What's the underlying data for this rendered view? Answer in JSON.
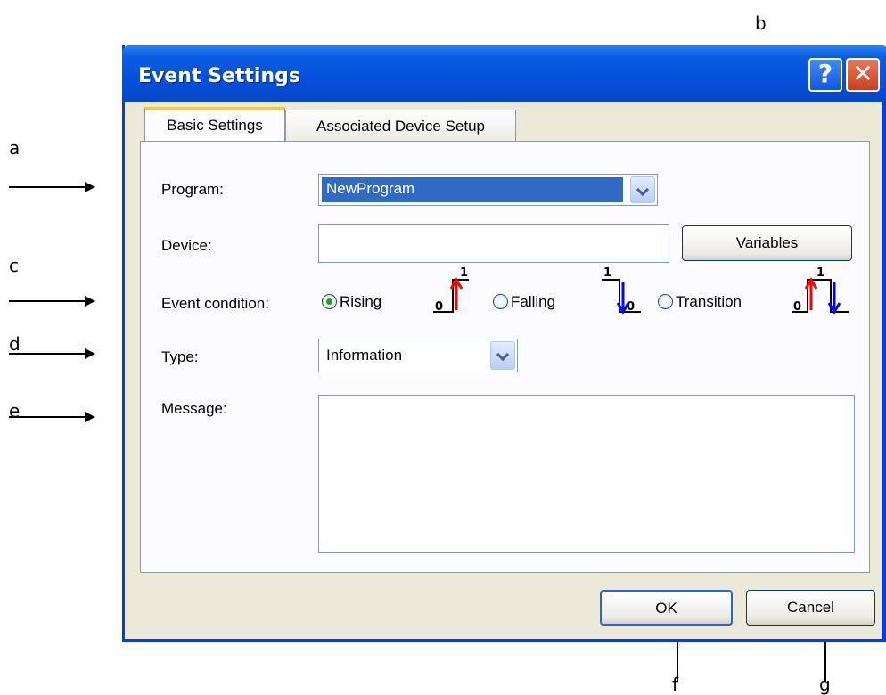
{
  "annotations": {
    "a": "a",
    "b": "b",
    "c": "c",
    "d": "d",
    "e": "e",
    "f": "f",
    "g": "g"
  },
  "window": {
    "title": "Event Settings",
    "help_label": "?",
    "close_label": "✕"
  },
  "tabs": [
    {
      "label": "Basic Settings",
      "active": true
    },
    {
      "label": "Associated Device Setup",
      "active": false
    }
  ],
  "form": {
    "program_label": "Program:",
    "program_value": "NewProgram",
    "device_label": "Device:",
    "device_value": "",
    "variables_button": "Variables",
    "event_condition_label": "Event condition:",
    "event_options": [
      {
        "label": "Rising",
        "selected": true
      },
      {
        "label": "Falling",
        "selected": false
      },
      {
        "label": "Transition",
        "selected": false
      }
    ],
    "type_label": "Type:",
    "type_value": "Information",
    "message_label": "Message:",
    "message_value": ""
  },
  "buttons": {
    "ok": "OK",
    "cancel": "Cancel"
  },
  "colors": {
    "rising_signal": "#ff0000",
    "falling_signal": "#0000ff"
  },
  "icon_digits": {
    "rising_high": "1",
    "rising_low": "0",
    "falling_high": "1",
    "falling_low": "0",
    "transition_high": "1",
    "transition_low": "0"
  }
}
